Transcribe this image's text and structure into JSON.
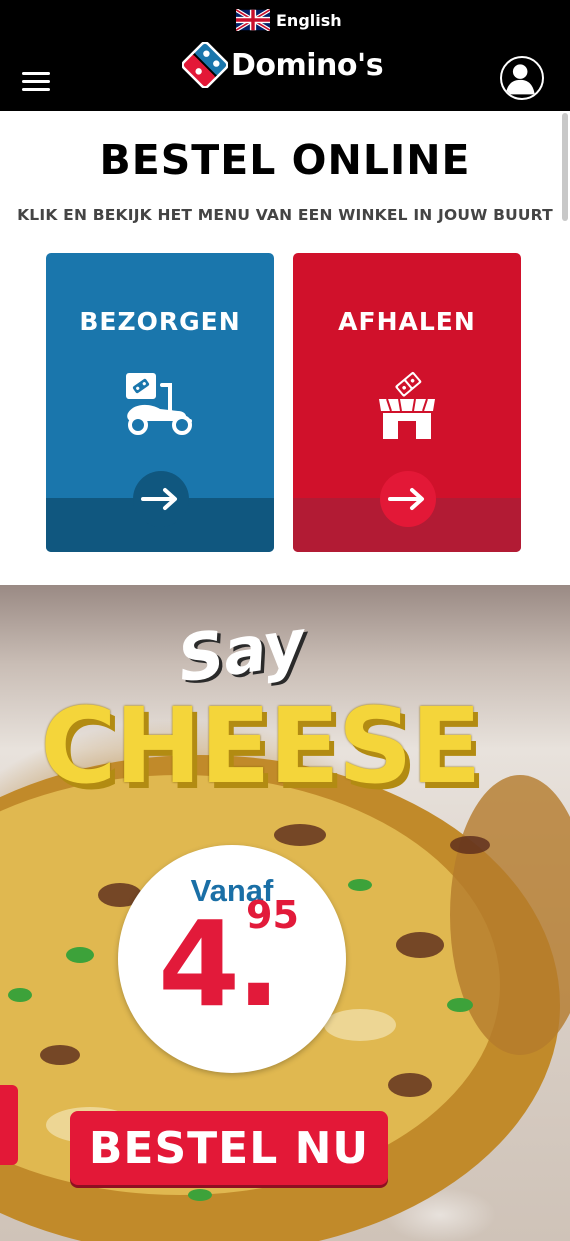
{
  "header": {
    "language_label": "English",
    "brand_name": "Domino's",
    "icons": {
      "flag": "uk-flag-icon",
      "menu": "hamburger-menu-icon",
      "account": "user-account-icon"
    },
    "colors": {
      "background": "#000000",
      "text": "#ffffff"
    }
  },
  "main": {
    "title": "BESTEL ONLINE",
    "subtitle": "KLIK EN BEKIJK HET MENU VAN EEN WINKEL IN JOUW BUURT",
    "options": [
      {
        "label": "BEZORGEN",
        "icon": "delivery-scooter-icon",
        "action_icon": "arrow-right-icon",
        "color": "#1a76ac"
      },
      {
        "label": "AFHALEN",
        "icon": "store-pickup-icon",
        "action_icon": "arrow-right-icon",
        "color": "#d0112b"
      }
    ]
  },
  "promo": {
    "headline_small": "Say",
    "headline_large": "CHEESE",
    "price_prefix": "Vanaf",
    "price_whole": "4.",
    "price_cents": "95",
    "cta_label": "BESTEL NU",
    "colors": {
      "headline": "#f4d53a",
      "price": "#e21a3a",
      "price_prefix": "#1a6fa6",
      "cta": "#e31837"
    }
  }
}
